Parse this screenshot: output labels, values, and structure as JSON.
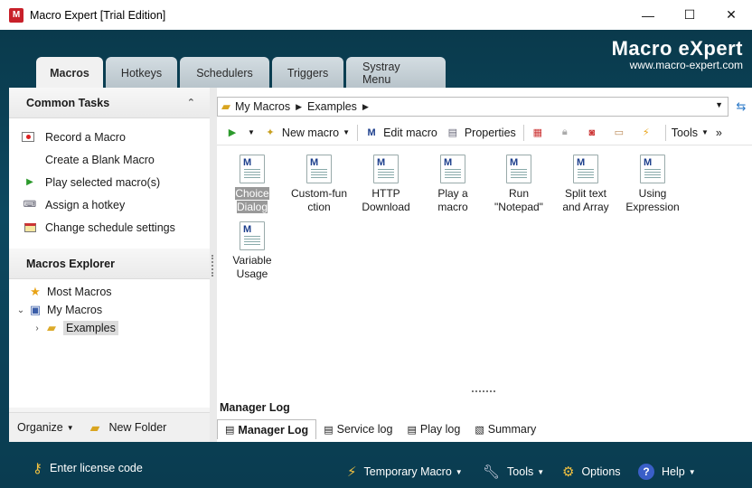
{
  "window": {
    "title": "Macro Expert [Trial Edition]",
    "app_icon_letter": "M",
    "minimize": "—",
    "maximize": "☐",
    "close": "✕"
  },
  "brand": {
    "title": "Macro eXpert",
    "url": "www.macro-expert.com"
  },
  "tabs": [
    {
      "label": "Macros",
      "active": true
    },
    {
      "label": "Hotkeys"
    },
    {
      "label": "Schedulers"
    },
    {
      "label": "Triggers"
    },
    {
      "label": "Systray Menu"
    }
  ],
  "common_tasks": {
    "title": "Common Tasks",
    "items": [
      {
        "label": "Record a Macro",
        "icon": "record-icon"
      },
      {
        "label": "Create a Blank Macro",
        "icon": ""
      },
      {
        "label": "Play selected macro(s)",
        "icon": "play-icon"
      },
      {
        "label": "Assign a hotkey",
        "icon": "keyboard-icon"
      },
      {
        "label": "Change schedule settings",
        "icon": "schedule-icon"
      }
    ]
  },
  "explorer": {
    "title": "Macros Explorer",
    "items": [
      {
        "label": "Most Macros",
        "icon": "star-icon"
      },
      {
        "label": "My Macros",
        "icon": "computer-icon"
      },
      {
        "label": "Examples",
        "icon": "folder-icon",
        "selected": true
      }
    ]
  },
  "left_footer": {
    "organize": "Organize",
    "new_folder": "New Folder"
  },
  "address": {
    "path": [
      "My Macros",
      "Examples"
    ]
  },
  "toolbar": {
    "new_macro": "New macro",
    "edit_macro": "Edit macro",
    "properties": "Properties",
    "tools": "Tools",
    "more": "»"
  },
  "macros": [
    {
      "line1": "Choice",
      "line2": "Dialog",
      "selected": true
    },
    {
      "line1": "Custom-fun",
      "line2": "ction"
    },
    {
      "line1": "HTTP",
      "line2": "Download"
    },
    {
      "line1": "Play a",
      "line2": "macro"
    },
    {
      "line1": "Run",
      "line2": "\"Notepad\""
    },
    {
      "line1": "Split text",
      "line2": "and Array"
    },
    {
      "line1": "Using",
      "line2": "Expression"
    },
    {
      "line1": "Variable",
      "line2": "Usage"
    }
  ],
  "manager_log": {
    "title": "Manager Log",
    "tabs": [
      {
        "label": "Manager Log",
        "active": true
      },
      {
        "label": "Service log"
      },
      {
        "label": "Play log"
      },
      {
        "label": "Summary"
      }
    ]
  },
  "bottom": {
    "license": "Enter license code",
    "temporary_macro": "Temporary Macro",
    "tools": "Tools",
    "options": "Options",
    "help": "Help"
  },
  "colors": {
    "frame": "#0c4860",
    "accent": "#c8202a"
  }
}
